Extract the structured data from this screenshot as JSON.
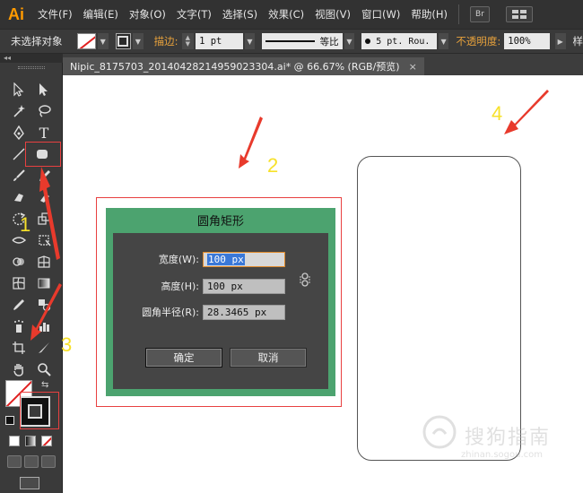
{
  "app": {
    "logo": "Ai"
  },
  "menu": {
    "items": [
      "文件(F)",
      "编辑(E)",
      "对象(O)",
      "文字(T)",
      "选择(S)",
      "效果(C)",
      "视图(V)",
      "窗口(W)",
      "帮助(H)"
    ],
    "bridge_label": "Br",
    "workspace_icon": "grid-icon"
  },
  "control_bar": {
    "selection_status": "未选择对象",
    "stroke_label": "描边:",
    "stroke_weight": "1 pt",
    "line_style": "等比",
    "brush_size": "5 pt. Rou.",
    "opacity_label": "不透明度:",
    "opacity_value": "100%",
    "style_label": "样"
  },
  "document": {
    "tab_title": "Nipic_8175703_20140428214959023304.ai* @ 66.67% (RGB/预览)",
    "close_glyph": "×"
  },
  "dialog": {
    "title": "圆角矩形",
    "fields": [
      {
        "label": "宽度(W):",
        "value": "100 px"
      },
      {
        "label": "高度(H):",
        "value": "100 px"
      },
      {
        "label": "圆角半径(R):",
        "value": "28.3465 px"
      }
    ],
    "ok_label": "确定",
    "cancel_label": "取消"
  },
  "annotations": {
    "step_1": "1",
    "step_2": "2",
    "step_3": "3",
    "step_4": "4",
    "arrow_color": "#e83a2c",
    "number_color": "#f7e12a"
  },
  "watermark": {
    "text": "搜狗指南",
    "sub": "zhinan.sogou.com"
  },
  "colors": {
    "dialog_title_bg": "#4ca36f",
    "highlight_outline": "#e84040",
    "stroke_label": "#e8a23c"
  }
}
